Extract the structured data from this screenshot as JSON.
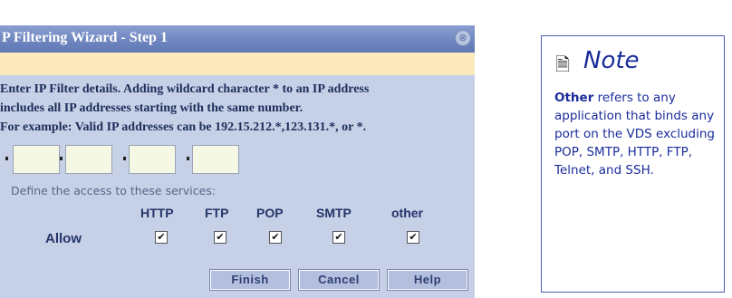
{
  "wizard": {
    "title": "P Filtering Wizard - Step 1",
    "close_glyph": "⊗",
    "instructions": [
      "Enter IP Filter details. Adding wildcard character * to an IP address",
      "includes all IP addresses starting with the same number.",
      "For example: Valid IP addresses can be 192.15.212.*,123.131.*, or *."
    ],
    "ip_octets": [
      "",
      "",
      "",
      ""
    ],
    "define_label": "Define the access to these services:",
    "services": [
      "HTTP",
      "FTP",
      "POP",
      "SMTP",
      "other"
    ],
    "allow_label": "Allow",
    "allow_checked": [
      true,
      true,
      true,
      true,
      true
    ],
    "buttons": {
      "finish": "Finish",
      "cancel": "Cancel",
      "help": "Help"
    }
  },
  "note": {
    "icon": "document-icon",
    "title": "Note",
    "body_bold": "Other",
    "body_text": " refers to any application that binds any port on the VDS excluding POP, SMTP, HTTP, FTP, Telnet, and SSH."
  },
  "colors": {
    "titlebar": "#6f86c0",
    "panel": "#c6d0e6",
    "band": "#fbe9bd",
    "note_text": "#1a2c9a"
  }
}
